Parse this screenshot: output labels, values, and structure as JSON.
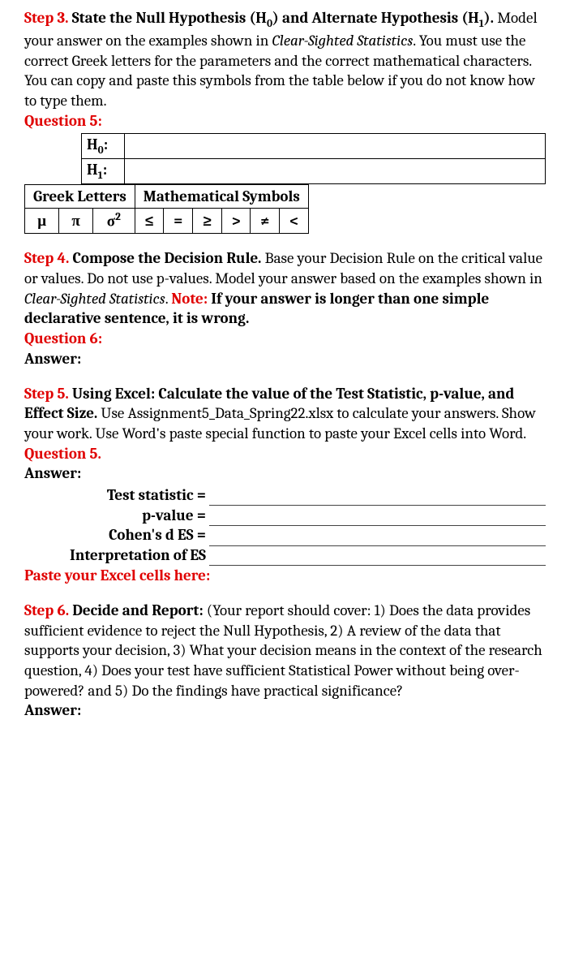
{
  "step3": {
    "label": "Step 3.",
    "heading_part1": "State the Null Hypothesis (H",
    "heading_sub1": "0",
    "heading_part2": ") and Alternate Hypothesis (H",
    "heading_sub2": "1",
    "heading_part3": ").",
    "body1": " Model your answer on the examples shown in ",
    "body_italic": "Clear-Sighted Statistics",
    "body2": ". You must use the correct Greek letters for the parameters and the correct mathematical characters. You can copy and paste this symbols from the table below if you do not know how to type them.",
    "question": "Question 5:",
    "h0_label": "H",
    "h0_sub": "0",
    "h0_colon": ":",
    "h1_label": "H",
    "h1_sub": "1",
    "h1_colon": ":",
    "greek_header": "Greek Letters",
    "math_header": "Mathematical Symbols",
    "symbols": {
      "mu": "μ",
      "pi": "π",
      "sigma2_base": "σ",
      "sigma2_sup": "2",
      "le": "≤",
      "eq": "=",
      "ge": "≥",
      "gt": ">",
      "ne": "≠",
      "lt": "<"
    }
  },
  "step4": {
    "label": "Step 4.",
    "heading": "Compose the Decision Rule.",
    "body1": " Base your Decision Rule on the critical value or values. Do not use p-values. Model your answer based on the examples shown in ",
    "body_italic": "Clear-Sighted Statistics",
    "body2": ". ",
    "note_label": "Note:",
    "note_body": " If your answer is longer than one simple declarative sentence, it is wrong.",
    "question": "Question 6:",
    "answer": "Answer:"
  },
  "step5": {
    "label": "Step 5.",
    "heading": "Using Excel: Calculate the value of the Test Statistic, p-value, and Effect Size.",
    "body": " Use Assignment5_Data_Spring22.xlsx to calculate your answers. Show your work. Use Word's paste special function to paste your Excel cells into Word.",
    "question": "Question 5.",
    "answer": "Answer:",
    "rows": {
      "test_stat": "Test statistic =",
      "pvalue": "p-value =",
      "cohen": "Cohen's d ES =",
      "interp": "Interpretation of ES"
    },
    "paste": "Paste your Excel cells here:"
  },
  "step6": {
    "label": "Step 6.",
    "heading": "Decide and Report:",
    "body": " (Your report should cover: 1) Does the data provides sufficient evidence to reject the Null Hypothesis, 2) A review of the data that supports your decision, 3) What your decision means in the context of the research question, 4) Does your test have sufficient Statistical Power without being over-powered? and 5) Do the findings have practical significance?",
    "answer": "Answer:"
  }
}
